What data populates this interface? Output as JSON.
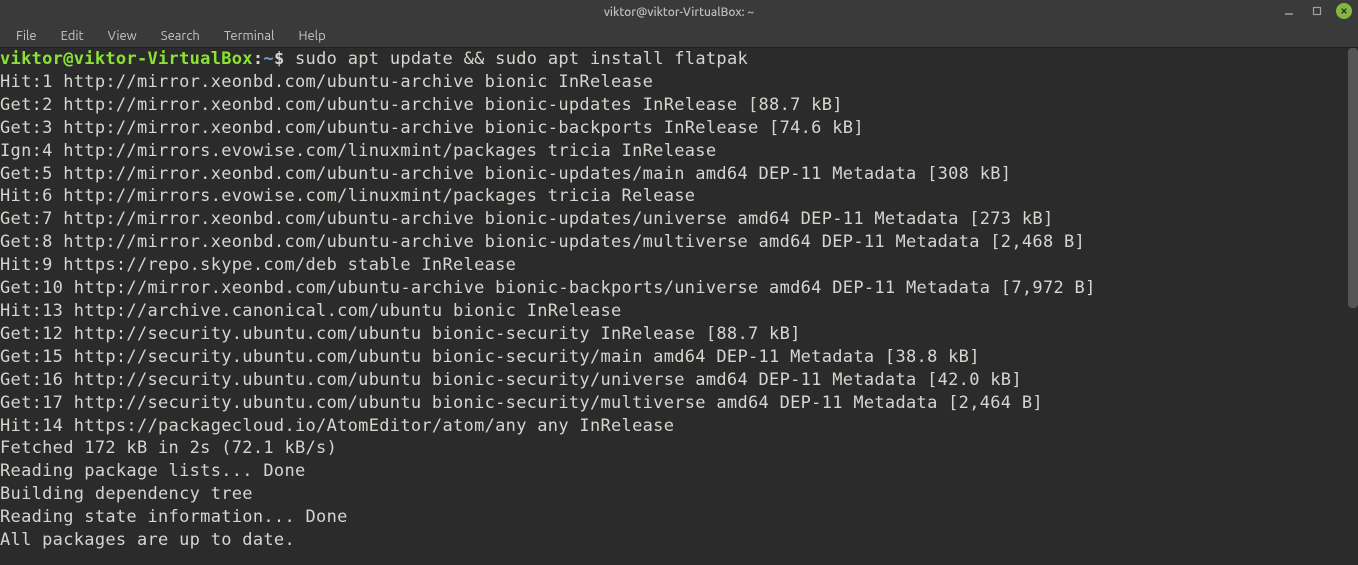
{
  "titlebar": {
    "title": "viktor@viktor-VirtualBox: ~"
  },
  "menu": {
    "file": "File",
    "edit": "Edit",
    "view": "View",
    "search": "Search",
    "terminal": "Terminal",
    "help": "Help"
  },
  "prompt": {
    "user_host": "viktor@viktor-VirtualBox",
    "colon": ":",
    "path": "~",
    "symbol": "$"
  },
  "command": " sudo apt update && sudo apt install flatpak",
  "output": [
    "Hit:1 http://mirror.xeonbd.com/ubuntu-archive bionic InRelease",
    "Get:2 http://mirror.xeonbd.com/ubuntu-archive bionic-updates InRelease [88.7 kB]",
    "Get:3 http://mirror.xeonbd.com/ubuntu-archive bionic-backports InRelease [74.6 kB]",
    "Ign:4 http://mirrors.evowise.com/linuxmint/packages tricia InRelease",
    "Get:5 http://mirror.xeonbd.com/ubuntu-archive bionic-updates/main amd64 DEP-11 Metadata [308 kB]",
    "Hit:6 http://mirrors.evowise.com/linuxmint/packages tricia Release",
    "Get:7 http://mirror.xeonbd.com/ubuntu-archive bionic-updates/universe amd64 DEP-11 Metadata [273 kB]",
    "Get:8 http://mirror.xeonbd.com/ubuntu-archive bionic-updates/multiverse amd64 DEP-11 Metadata [2,468 B]",
    "Hit:9 https://repo.skype.com/deb stable InRelease",
    "Get:10 http://mirror.xeonbd.com/ubuntu-archive bionic-backports/universe amd64 DEP-11 Metadata [7,972 B]",
    "Hit:13 http://archive.canonical.com/ubuntu bionic InRelease",
    "Get:12 http://security.ubuntu.com/ubuntu bionic-security InRelease [88.7 kB]",
    "Get:15 http://security.ubuntu.com/ubuntu bionic-security/main amd64 DEP-11 Metadata [38.8 kB]",
    "Get:16 http://security.ubuntu.com/ubuntu bionic-security/universe amd64 DEP-11 Metadata [42.0 kB]",
    "Get:17 http://security.ubuntu.com/ubuntu bionic-security/multiverse amd64 DEP-11 Metadata [2,464 B]",
    "Hit:14 https://packagecloud.io/AtomEditor/atom/any any InRelease",
    "Fetched 172 kB in 2s (72.1 kB/s)",
    "Reading package lists... Done",
    "Building dependency tree",
    "Reading state information... Done",
    "All packages are up to date."
  ]
}
